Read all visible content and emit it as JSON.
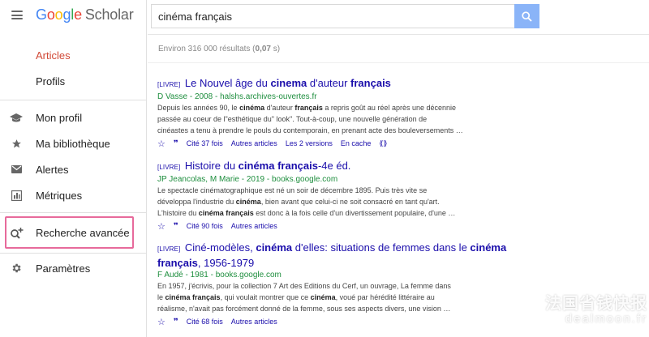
{
  "logo": {
    "google": "Google",
    "scholar": "Scholar"
  },
  "sidebar": {
    "articles": "Articles",
    "profils": "Profils",
    "items": [
      {
        "label": "Mon profil",
        "icon": "graduation-cap-icon"
      },
      {
        "label": "Ma bibliothèque",
        "icon": "star-icon"
      },
      {
        "label": "Alertes",
        "icon": "envelope-icon"
      },
      {
        "label": "Métriques",
        "icon": "metrics-icon"
      },
      {
        "label": "Recherche avancée",
        "icon": "advanced-search-icon"
      },
      {
        "label": "Paramètres",
        "icon": "gear-icon"
      }
    ]
  },
  "search": {
    "value": "cinéma français"
  },
  "stats": {
    "prefix": "Environ 316 000 résultats (",
    "time": "0,07",
    "suffix": " s)"
  },
  "results": [
    {
      "type": "[LIVRE]",
      "title_parts": [
        "Le Nouvel âge du ",
        "cinema",
        " d'auteur ",
        "français"
      ],
      "source": "D Vasse - 2008 - halshs.archives-ouvertes.fr",
      "snippet": [
        [
          "Depuis les années 90, le ",
          "cinéma",
          " d'auteur ",
          "français",
          " a repris goût au réel après une décennie"
        ],
        [
          "passée au coeur de l\"esthétique du\" look\". Tout-à-coup, une nouvelle génération de"
        ],
        [
          "cinéastes a tenu à prendre le pouls du contemporain, en prenant acte des bouleversements …"
        ]
      ],
      "cited": "Cité 37 fois",
      "related": "Autres articles",
      "versions": "Les 2 versions",
      "cache": "En cache"
    },
    {
      "type": "[LIVRE]",
      "title_parts": [
        "Histoire du ",
        "cinéma français",
        "-4e éd."
      ],
      "source": "JP Jeancolas, M Marie - 2019 - books.google.com",
      "snippet": [
        [
          "Le spectacle cinématographique est né un soir de décembre 1895. Puis très vite se"
        ],
        [
          "développa l'industrie du ",
          "cinéma",
          ", bien avant que celui-ci ne soit consacré en tant qu'art."
        ],
        [
          "L'histoire du ",
          "cinéma français",
          " est donc à la fois celle d'un divertissement populaire, d'une …"
        ]
      ],
      "cited": "Cité 90 fois",
      "related": "Autres articles"
    },
    {
      "type": "[LIVRE]",
      "title_line1": [
        "Ciné-modèles, ",
        "cinéma",
        " d'elles: situations de femmes dans le ",
        "cinéma"
      ],
      "title_line2": [
        "français",
        ", 1956-1979"
      ],
      "source": "F Audé - 1981 - books.google.com",
      "snippet": [
        [
          "En 1957, j'écrivis, pour la collection 7 Art des Editions du Cerf, un ouvrage, La femme dans"
        ],
        [
          "le ",
          "cinéma français",
          ", qui voulait montrer que ce ",
          "cinéma",
          ", voué par hérédité littéraire au"
        ],
        [
          "réalisme, n'avait pas forcément donné de la femme, sous ses aspects divers, une vision …"
        ]
      ],
      "cited": "Cité 68 fois",
      "related": "Autres articles"
    }
  ],
  "watermark": {
    "cn": "法国省钱快报",
    "en": "dealmoon.fr"
  },
  "colors": {
    "accent": "#d14836",
    "link": "#1a0dab",
    "source": "#1e8e3e",
    "highlight": "#e76a9b"
  }
}
